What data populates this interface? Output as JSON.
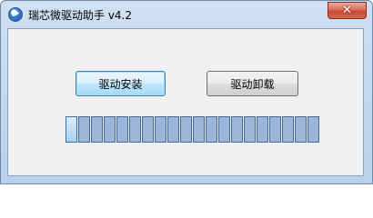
{
  "window": {
    "title": "瑞芯微驱动助手 v4.2",
    "app_icon": "app-logo-icon",
    "close_glyph": "✕"
  },
  "buttons": {
    "install_label": "驱动安装",
    "uninstall_label": "驱动卸载"
  },
  "progress": {
    "total_segments": 20,
    "filled_segments": 1,
    "progress_fraction": 0.05
  },
  "colors": {
    "accent": "#3c7fb1",
    "progress_segment": "#9bb6d6",
    "close_button": "#c24a35"
  }
}
